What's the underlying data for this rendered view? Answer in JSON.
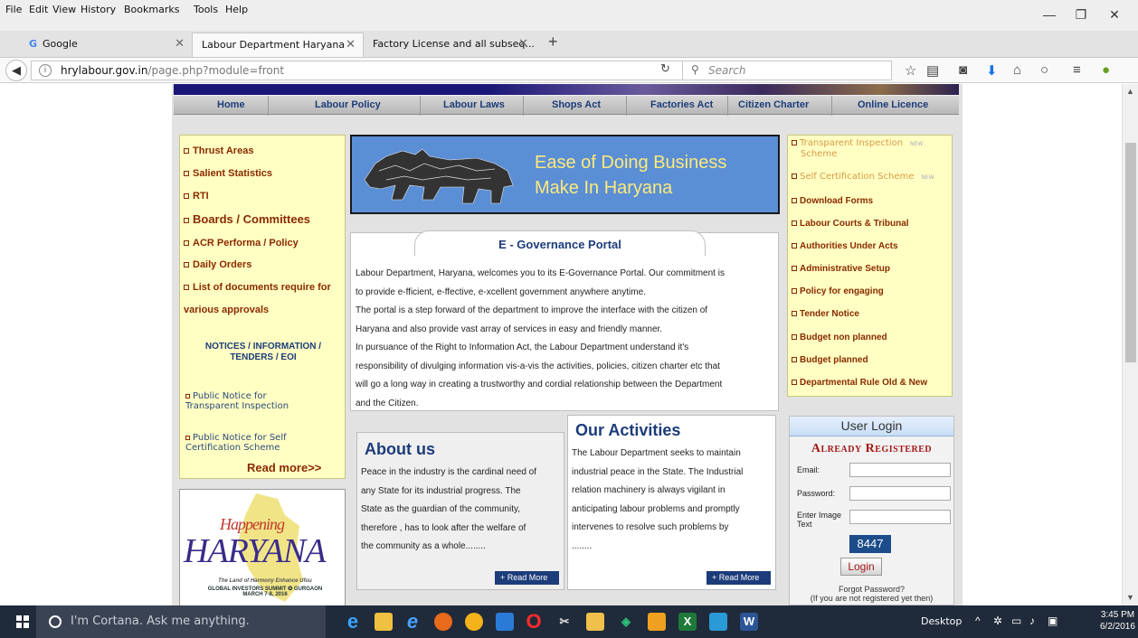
{
  "menubar": {
    "items": [
      "File",
      "Edit",
      "View",
      "History",
      "Bookmarks",
      "Tools",
      "Help"
    ]
  },
  "tabs": [
    {
      "label": "Google",
      "active": false
    },
    {
      "label": "Labour Department Haryana",
      "active": true
    },
    {
      "label": "Factory License and all subseq...",
      "active": false
    }
  ],
  "navbar": {
    "url_host": "hrylabour.gov.in",
    "url_path": "/page.php?module=front",
    "search_placeholder": "Search"
  },
  "site": {
    "topnav": [
      "Home",
      "Labour Policy",
      "Labour Laws",
      "Shops Act",
      "Factories Act",
      "Citizen Charter",
      "Online Licence"
    ],
    "left_links": [
      {
        "label": "Thrust Areas"
      },
      {
        "label": "Salient Statistics"
      },
      {
        "label": "RTI"
      },
      {
        "label": "Boards / Committees"
      },
      {
        "label": "ACR Performa / Policy"
      },
      {
        "label": "Daily Orders"
      },
      {
        "label": "List of documents require for"
      }
    ],
    "left_link_cont": "various approvals",
    "notices_heading": "NOTICES / INFORMATION / TENDERS / EOI",
    "notices": [
      {
        "line1": "Public Notice for",
        "line2": "Transparent Inspection"
      },
      {
        "line1": "Public Notice for Self",
        "line2": "Certification Scheme"
      }
    ],
    "read_more_left": "Read more>>",
    "logo": {
      "title": "HARYANA",
      "script": "Happening",
      "tagline": "The Land of Harmony Enhance Ufuu",
      "summit": "GLOBAL INVESTORS SUMMIT ✪ GURGAON",
      "dates": "MARCH 7-8, 2016"
    },
    "ease": {
      "line1": "Ease of Doing Business",
      "line2": "Make In Haryana"
    },
    "egov_title": "E - Governance Portal",
    "egov_lines": [
      "Labour Department, Haryana, welcomes you to its E-Governance Portal. Our commitment is",
      "to provide e-fficient, e-ffective, e-xcellent government anywhere anytime.",
      "The portal is a step forward of the department to improve the interface with the citizen of",
      "Haryana and also provide vast array of services in easy and friendly manner.",
      "In pursuance of the Right to Information Act, the Labour Department understand it's",
      "responsibility of divulging information vis-a-vis the activities, policies, citizen charter etc that",
      "will go a long way in creating a trustworthy and cordial relationship between the Department",
      "and the Citizen."
    ],
    "about": {
      "title": "About us",
      "lines": [
        "Peace in the industry is the cardinal need of",
        "any State for its industrial progress. The",
        "State as the guardian of the community,",
        "therefore , has to look after the welfare of",
        "the community as a whole........"
      ],
      "read_more": "+ Read More"
    },
    "activities": {
      "title": "Our Activities",
      "lines": [
        "The Labour Department seeks to maintain",
        "industrial peace in the State. The Industrial",
        "relation machinery is always vigilant in",
        "anticipating labour problems and promptly",
        "intervenes to resolve such problems by",
        "........"
      ],
      "read_more": "+ Read More"
    },
    "right_links_pale": [
      {
        "line1": "Transparent Inspection",
        "line2": "Scheme"
      },
      {
        "line1": "Self Certification Scheme",
        "line2": ""
      }
    ],
    "new_badge": "NEW",
    "right_links": [
      "Download Forms",
      "Labour Courts & Tribunal",
      "Authorities Under Acts",
      "Administrative Setup",
      "Policy for engaging",
      "Tender Notice",
      "Budget non planned",
      "Budget planned",
      "Departmental Rule Old & New"
    ],
    "login": {
      "head": "User Login",
      "already": "Already Registered",
      "email_label": "Email:",
      "password_label": "Password:",
      "captcha_label": "Enter Image Text",
      "captcha_value": "8447",
      "login_btn": "Login",
      "forgot": "Forgot Password?",
      "not_registered": "(If you are not registered yet then)"
    }
  },
  "taskbar": {
    "cortana": "I'm Cortana. Ask me anything.",
    "desktop": "Desktop",
    "time": "3:45 PM",
    "date": "6/2/2016"
  },
  "colors": {
    "site_blue": "#1c3c7a",
    "link_brown": "#8a2a00",
    "box_yellow": "#ffffc3",
    "ease_blue": "#5a8fd6",
    "taskbar": "#1f2a3a"
  }
}
